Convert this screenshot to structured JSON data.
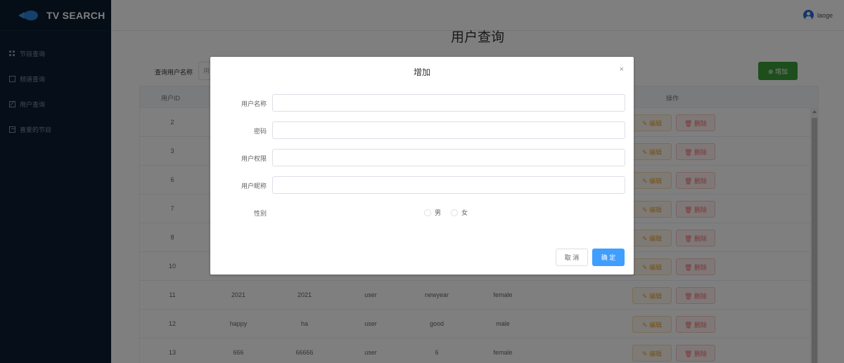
{
  "app": {
    "title": "TV SEARCH"
  },
  "sidebar": {
    "items": [
      {
        "label": "节目查询",
        "icon": "grid-icon"
      },
      {
        "label": "频道查询",
        "icon": "monitor-icon"
      },
      {
        "label": "用户查询",
        "icon": "edit-icon"
      },
      {
        "label": "喜爱的节目",
        "icon": "image-icon"
      }
    ]
  },
  "header": {
    "username": "laoge"
  },
  "main": {
    "title": "用户查询",
    "search_label": "查询用户名称",
    "search_placeholder": "用",
    "add_label": "⊕ 增加",
    "columns": {
      "id": "用户ID",
      "actions": "操作"
    },
    "edit_label": "✎ 编辑",
    "delete_label": "🗑 删除",
    "rows": [
      {
        "id": "2",
        "c1": "",
        "c2": "",
        "c3": "",
        "c4": "",
        "c5": ""
      },
      {
        "id": "3",
        "c1": "",
        "c2": "",
        "c3": "",
        "c4": "",
        "c5": ""
      },
      {
        "id": "6",
        "c1": "",
        "c2": "",
        "c3": "",
        "c4": "",
        "c5": ""
      },
      {
        "id": "7",
        "c1": "",
        "c2": "",
        "c3": "",
        "c4": "",
        "c5": ""
      },
      {
        "id": "8",
        "c1": "",
        "c2": "",
        "c3": "",
        "c4": "",
        "c5": ""
      },
      {
        "id": "10",
        "c1": "",
        "c2": "",
        "c3": "",
        "c4": "",
        "c5": ""
      },
      {
        "id": "11",
        "c1": "2021",
        "c2": "2021",
        "c3": "user",
        "c4": "newyear",
        "c5": "female"
      },
      {
        "id": "12",
        "c1": "happy",
        "c2": "ha",
        "c3": "user",
        "c4": "good",
        "c5": "male"
      },
      {
        "id": "13",
        "c1": "666",
        "c2": "66666",
        "c3": "user",
        "c4": "6",
        "c5": "female"
      }
    ]
  },
  "dialog": {
    "title": "增加",
    "close": "×",
    "fields": {
      "username": {
        "label": "用户名称",
        "value": ""
      },
      "password": {
        "label": "密码",
        "value": ""
      },
      "permission": {
        "label": "用户权限",
        "value": ""
      },
      "nickname": {
        "label": "用户昵称",
        "value": ""
      }
    },
    "gender": {
      "label": "性别",
      "male": "男",
      "female": "女"
    },
    "cancel_label": "取 消",
    "ok_label": "确 定"
  },
  "colors": {
    "sidebar_bg": "#0c1e33",
    "add_button": "#3a9d37",
    "primary": "#409eff",
    "avatar": "#2e6bd8"
  }
}
